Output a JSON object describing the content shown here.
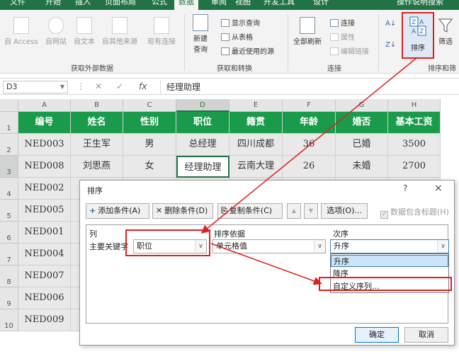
{
  "ribbon": {
    "tabs": [
      "文件",
      "开始",
      "插入",
      "页面布局",
      "公式",
      "数据",
      "审阅",
      "视图",
      "开发工具",
      "设计",
      "操作说明搜索"
    ],
    "get_external": {
      "buttons": [
        "自 Access",
        "自网站",
        "自文本",
        "自其他来源",
        "现有连接"
      ],
      "group_label": "获取外部数据"
    },
    "get_transform": {
      "new_query": "新建\n查询",
      "new_query_line1": "新建",
      "new_query_line2": "查询",
      "items": [
        "显示查询",
        "从表格",
        "最近使用的源"
      ],
      "group_label": "获取和转换"
    },
    "connections": {
      "refresh_all": "全部刷新",
      "items": [
        "连接",
        "属性",
        "编辑链接"
      ],
      "group_label": "连接"
    },
    "sort_filter": {
      "sort_label": "排序",
      "filter_label": "筛选",
      "group_label": "排序和筛"
    }
  },
  "formula_bar": {
    "name_box": "D3",
    "fx": "fx",
    "value": "经理助理"
  },
  "sheet": {
    "columns": [
      "A",
      "B",
      "C",
      "D",
      "E",
      "F",
      "G",
      "H"
    ],
    "rows": [
      "1",
      "2",
      "3",
      "4",
      "5",
      "6",
      "7",
      "8",
      "9",
      "10"
    ],
    "header": [
      "编号",
      "姓名",
      "性别",
      "职位",
      "籍贯",
      "年龄",
      "婚否",
      "基本工资"
    ],
    "data": [
      [
        "NED003",
        "王生军",
        "男",
        "总经理",
        "四川成都",
        "36",
        "已婚",
        "3500"
      ],
      [
        "NED008",
        "刘思燕",
        "女",
        "经理助理",
        "云南大理",
        "26",
        "未婚",
        "2700"
      ],
      [
        "NED002",
        "",
        "",
        "",
        "",
        "",
        "",
        ""
      ],
      [
        "NED005",
        "",
        "",
        "",
        "",
        "",
        "",
        ""
      ],
      [
        "NED001",
        "",
        "",
        "",
        "",
        "",
        "",
        ""
      ],
      [
        "NED004",
        "",
        "",
        "",
        "",
        "",
        "",
        ""
      ],
      [
        "NED007",
        "",
        "",
        "",
        "",
        "",
        "",
        ""
      ],
      [
        "NED006",
        "",
        "",
        "",
        "",
        "",
        "",
        ""
      ],
      [
        "NED009",
        "",
        "",
        "",
        "",
        "",
        "",
        ""
      ]
    ]
  },
  "dialog": {
    "title": "排序",
    "help": "?",
    "close": "×",
    "toolbar": {
      "add_level": "添加条件(A)",
      "delete_level": "删除条件(D)",
      "copy_level": "复制条件(C)",
      "options": "选项(O)...",
      "has_headers": "数据包含标题(H)"
    },
    "columns": {
      "column": "列",
      "sort_on": "排序依据",
      "order": "次序"
    },
    "primary_key_label": "主要关键字",
    "primary_key_value": "职位",
    "sort_on_value": "单元格值",
    "order_value": "升序",
    "order_options": [
      "升序",
      "降序",
      "自定义序列..."
    ],
    "ok": "确定",
    "cancel": "取消"
  },
  "colors": {
    "excel_green": "#217346",
    "header_fill": "#1a9b4b",
    "annotation_red": "#e02020"
  }
}
